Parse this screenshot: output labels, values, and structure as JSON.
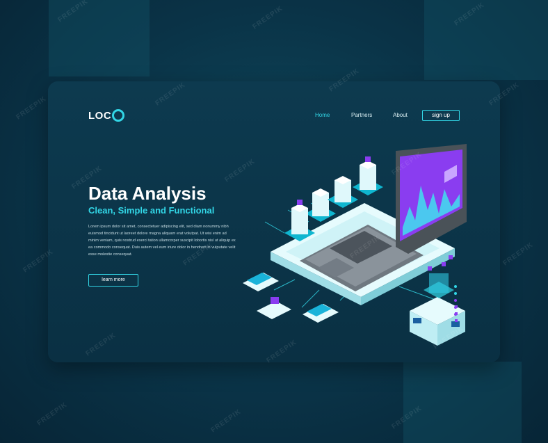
{
  "brand": {
    "logo_text": "LOC"
  },
  "nav": {
    "items": [
      {
        "label": "Home",
        "active": true
      },
      {
        "label": "Partners",
        "active": false
      },
      {
        "label": "About",
        "active": false
      }
    ],
    "signup_label": "sign up"
  },
  "hero": {
    "title": "Data Analysis",
    "subtitle": "Clean, Simple and Functional",
    "body": "Lorem ipsum dolor sit amet, consectetuer adipiscing elit, sed diam nonummy nibh euismod tincidunt ut laoreet dolore magna aliquam erat volutpat. Ut wisi enim ad minim veniam, quis nostrud exerci tation ullamcorper suscipit lobortis nisl ut aliquip ex ea commodo consequat. Duis autem vel eum iriure dolor in hendrerit in vulputate velit esse molestie consequat.",
    "cta_label": "learn more"
  },
  "watermark": "FREEPIK",
  "colors": {
    "accent": "#32d6e6",
    "background": "#0a3347",
    "card": "#0d3a4f",
    "screen": "#8a3df0"
  }
}
